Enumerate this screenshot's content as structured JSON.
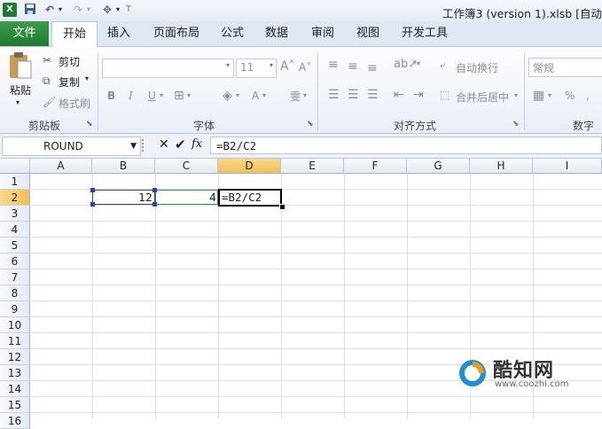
{
  "window": {
    "title": "工作簿3 (version 1).xlsb [自动"
  },
  "tabs": {
    "file": "文件",
    "items": [
      "开始",
      "插入",
      "页面布局",
      "公式",
      "数据",
      "审阅",
      "视图",
      "开发工具"
    ]
  },
  "ribbon": {
    "clipboard": {
      "paste": "粘贴",
      "cut": "剪切",
      "copy": "复制",
      "format_painter": "格式刷",
      "label": "剪贴板"
    },
    "font": {
      "size": "11",
      "bold": "B",
      "italic": "I",
      "underline": "U",
      "label": "字体"
    },
    "alignment": {
      "wrap": "自动换行",
      "merge": "合并后居中",
      "label": "对齐方式"
    },
    "number": {
      "format": "常规",
      "percent": "%",
      "label": "数字"
    }
  },
  "formula_bar": {
    "name_box": "ROUND",
    "cancel": "✕",
    "enter": "✔",
    "fx": "fx",
    "formula": "=B2/C2"
  },
  "sheet": {
    "columns": [
      "A",
      "B",
      "C",
      "D",
      "E",
      "F",
      "G",
      "H",
      "I"
    ],
    "rows": [
      "1",
      "2",
      "3",
      "4",
      "5",
      "6",
      "7",
      "8",
      "9",
      "10",
      "11",
      "12",
      "13",
      "14",
      "15",
      "16"
    ],
    "cells": {
      "B2": "12",
      "C2": "4",
      "D2": "=B2/C2"
    }
  },
  "watermark": {
    "brand": "酷知网",
    "url": "www.coozhi.com"
  }
}
